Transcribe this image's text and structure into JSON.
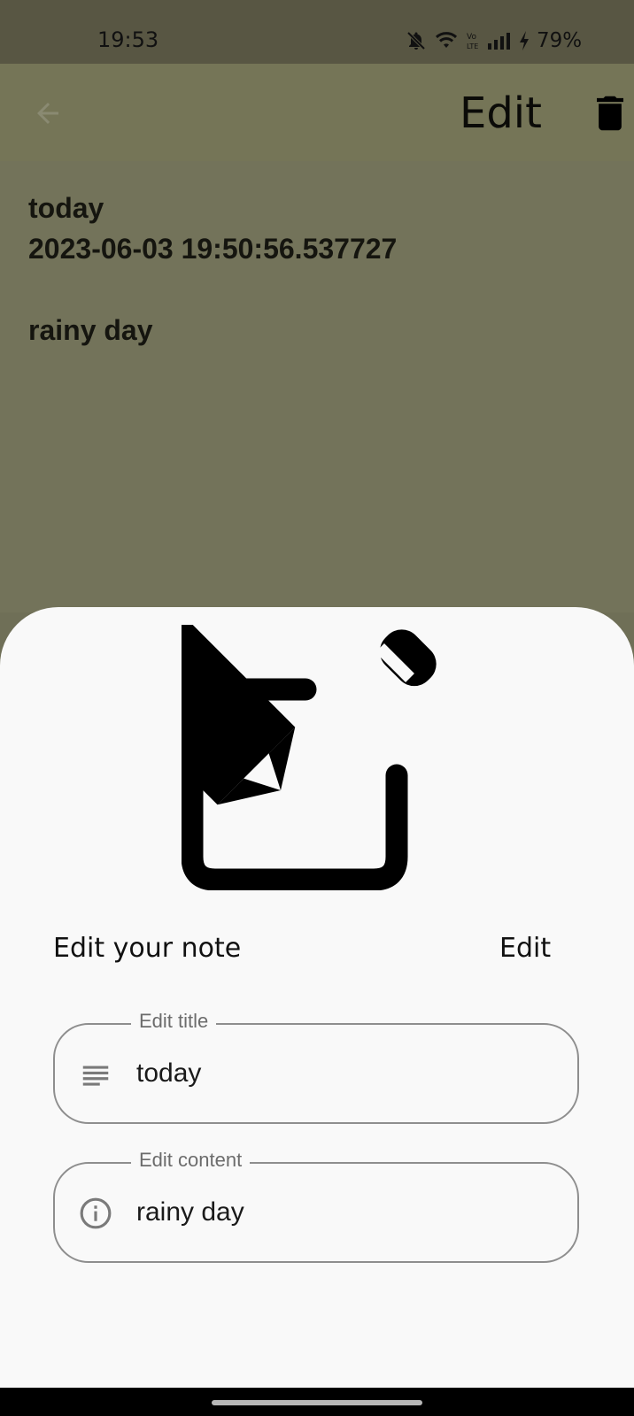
{
  "status_bar": {
    "time": "19:53",
    "battery": "79%",
    "icons": [
      "bell-off-icon",
      "wifi-icon",
      "volte-icon",
      "signal-icon",
      "charging-icon"
    ]
  },
  "app_bar": {
    "title": "Edit",
    "icons": [
      "arrow-back-icon",
      "delete-icon"
    ]
  },
  "note": {
    "title": "today",
    "timestamp": "2023-06-03 19:50:56.537727",
    "content": "rainy day"
  },
  "sheet": {
    "header_icon": "edit-note-icon",
    "title": "Edit your note",
    "edit_button": "Edit",
    "fields": [
      {
        "label": "Edit title",
        "value": "today",
        "icon": "notes-icon"
      },
      {
        "label": "Edit content",
        "value": "rainy day",
        "icon": "info-icon"
      }
    ]
  },
  "colors": {
    "scrim_background": "#73735a",
    "status_bar": "#585643",
    "sheet_background": "#f9f9f9",
    "field_border": "#8e8e8e"
  }
}
